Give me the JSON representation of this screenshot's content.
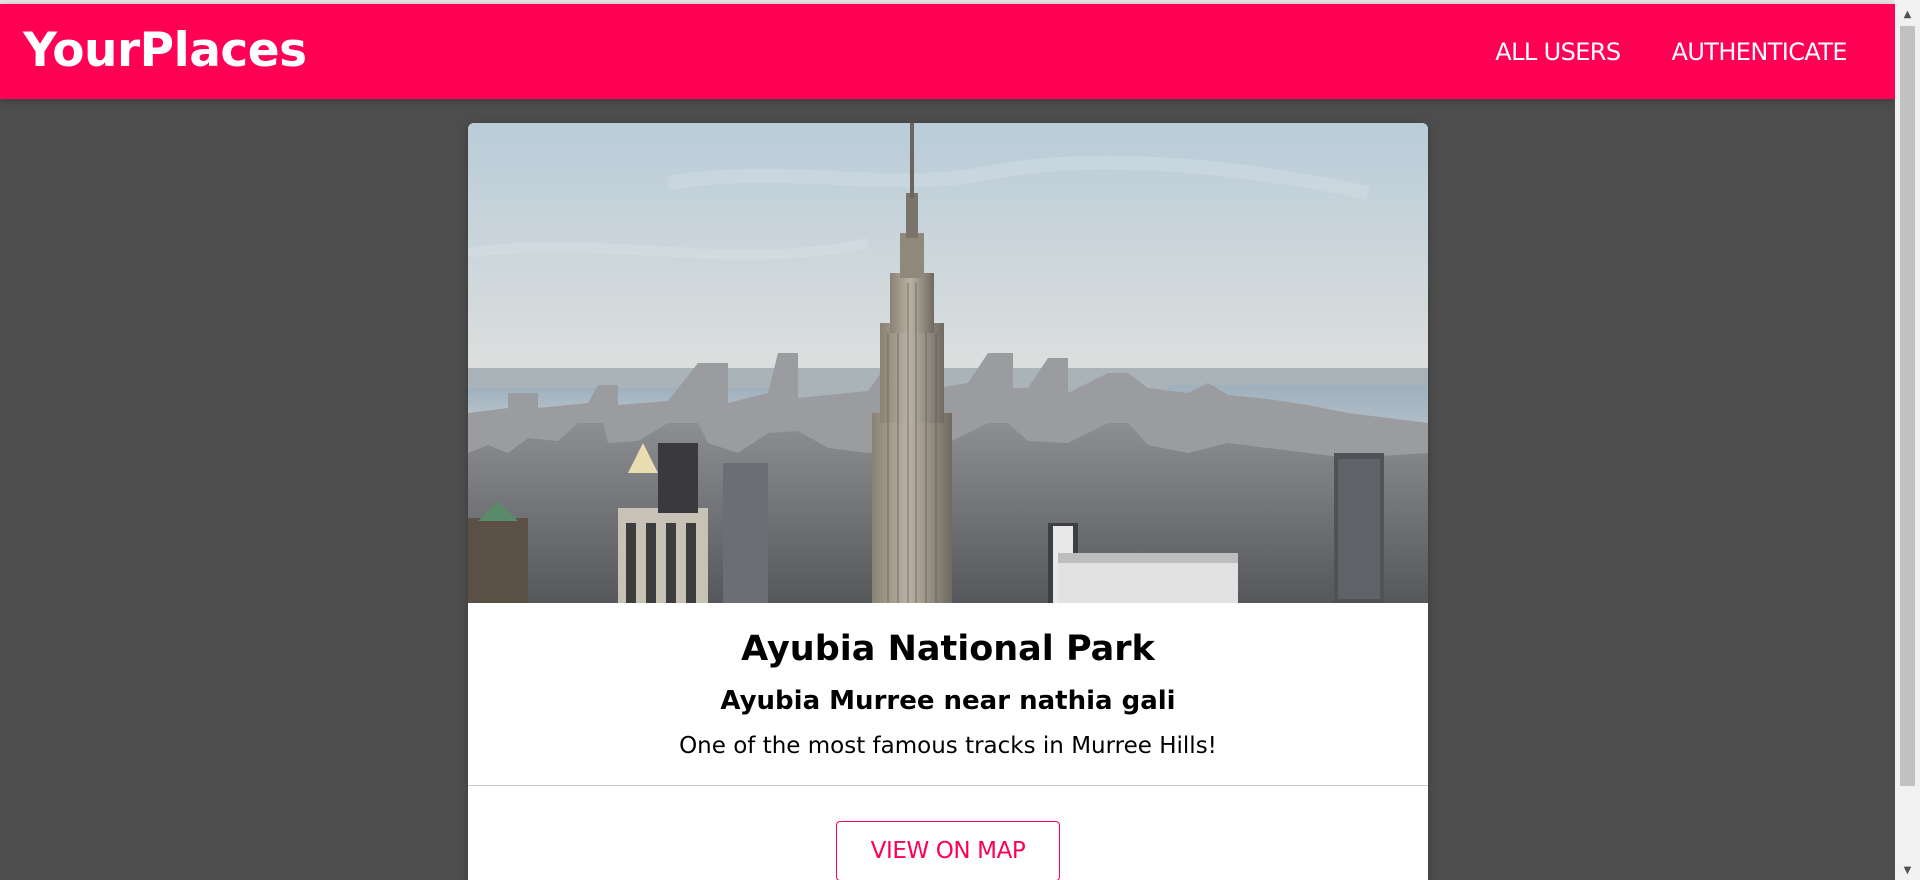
{
  "header": {
    "logo": "YourPlaces",
    "nav": [
      {
        "label": "ALL USERS"
      },
      {
        "label": "AUTHENTICATE"
      }
    ]
  },
  "place": {
    "title": "Ayubia National Park",
    "address": "Ayubia Murree near nathia gali",
    "description": "One of the most famous tracks in Murree Hills!",
    "action_label": "VIEW ON MAP"
  },
  "colors": {
    "brand": "#ff0055",
    "page_background": "#4d4d4d",
    "card_background": "#ffffff"
  },
  "icons": {
    "scroll_up": "scroll-up-arrow-icon",
    "scroll_down": "scroll-down-arrow-icon"
  }
}
